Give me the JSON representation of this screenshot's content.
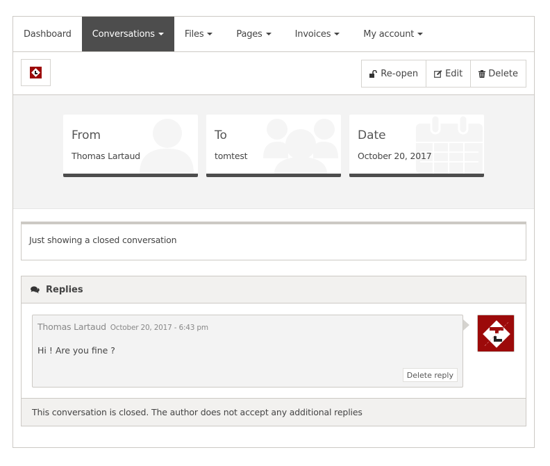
{
  "nav": {
    "items": [
      {
        "label": "Dashboard",
        "dropdown": false,
        "active": false
      },
      {
        "label": "Conversations",
        "dropdown": true,
        "active": true
      },
      {
        "label": "Files",
        "dropdown": true,
        "active": false
      },
      {
        "label": "Pages",
        "dropdown": true,
        "active": false
      },
      {
        "label": "Invoices",
        "dropdown": true,
        "active": false
      },
      {
        "label": "My account",
        "dropdown": true,
        "active": false
      }
    ]
  },
  "toolbar": {
    "logo_icon": "company-logo-icon",
    "reopen_label": "Re-open",
    "reopen_icon": "unlock-icon",
    "edit_label": "Edit",
    "edit_icon": "edit-icon",
    "delete_label": "Delete",
    "delete_icon": "trash-icon"
  },
  "info": {
    "from": {
      "title": "From",
      "value": "Thomas Lartaud",
      "icon": "user-icon"
    },
    "to": {
      "title": "To",
      "value": "tomtest",
      "icon": "users-icon"
    },
    "date": {
      "title": "Date",
      "value": "October 20, 2017",
      "icon": "calendar-icon"
    }
  },
  "message": {
    "text": "Just showing a closed conversation"
  },
  "replies": {
    "title": "Replies",
    "icon": "comments-icon",
    "items": [
      {
        "author": "Thomas Lartaud",
        "date": "October 20, 2017 - 6:43 pm",
        "body": "Hi ! Are you fine ?",
        "delete_label": "Delete reply"
      }
    ],
    "closed_notice": "This conversation is closed. The author does not accept any additional replies"
  },
  "colors": {
    "nav_active_bg": "#4d4d4d",
    "brand_red": "#9c0a0a",
    "panel_bg": "#f2f1ef",
    "band_bg": "#f3f3f3",
    "border": "#ccc9c4"
  }
}
